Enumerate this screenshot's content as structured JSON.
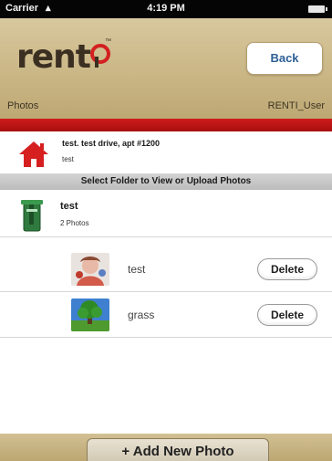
{
  "status_bar": {
    "carrier": "Carrier",
    "time": "4:19 PM"
  },
  "header": {
    "logo_text": "rent",
    "logo_tm": "™",
    "back_label": "Back",
    "section_label": "Photos",
    "user_label": "RENTI_User"
  },
  "property": {
    "title": "test. test drive, apt #1200",
    "subtitle": "test"
  },
  "folder_banner": "Select Folder to View or Upload Photos",
  "folder": {
    "name": "test",
    "count": "2 Photos"
  },
  "photos": [
    {
      "name": "test",
      "delete_label": "Delete"
    },
    {
      "name": "grass",
      "delete_label": "Delete"
    }
  ],
  "bottom": {
    "add_label": "+ Add New Photo"
  },
  "colors": {
    "brand_red": "#cf1b1b",
    "header_tan": "#c9b584",
    "back_text": "#2c5f95"
  }
}
